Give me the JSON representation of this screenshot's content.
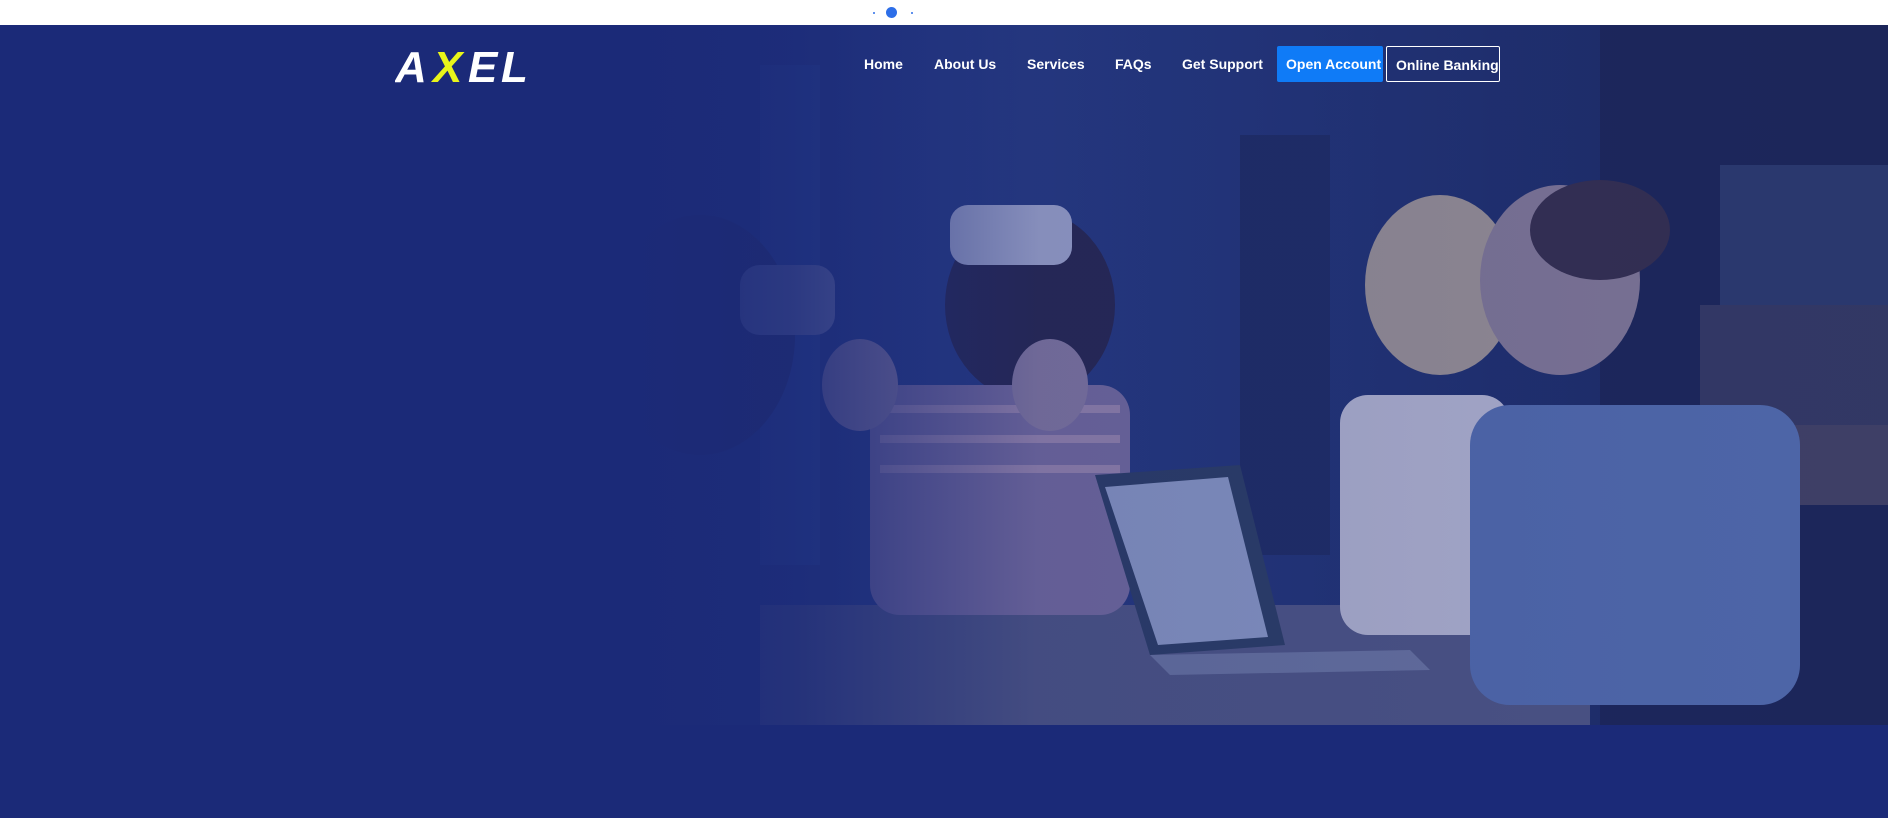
{
  "loader": {
    "active_index": 1,
    "count": 3
  },
  "brand": {
    "logo_text": "AXEL"
  },
  "nav": {
    "items": [
      {
        "label": "Home"
      },
      {
        "label": "About Us"
      },
      {
        "label": "Services"
      },
      {
        "label": "FAQs"
      },
      {
        "label": "Get Support"
      }
    ],
    "open_account": "Open Account",
    "online_banking": "Online Banking"
  },
  "colors": {
    "background": "#1b2a78",
    "primary_button": "#0f7bf7",
    "logo_accent": "#e9f51a",
    "loader_dot": "#2d6ee8"
  }
}
